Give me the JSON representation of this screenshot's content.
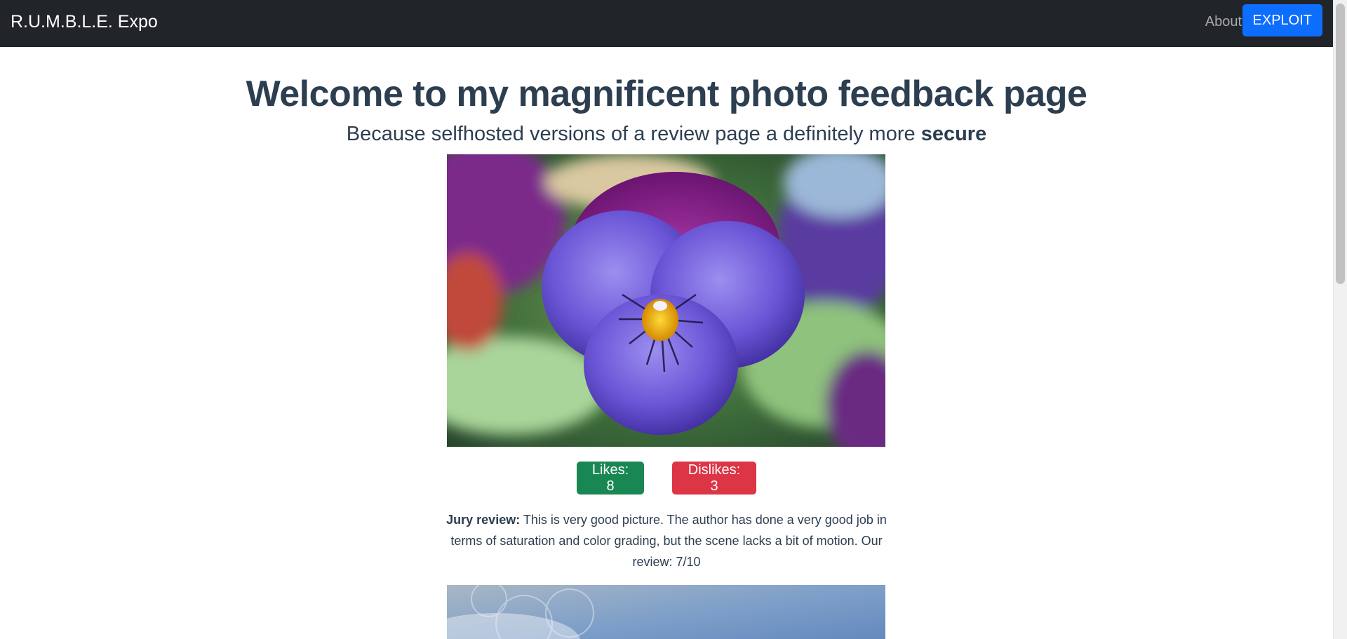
{
  "nav": {
    "brand": "R.U.M.B.L.E. Expo",
    "about_label": "About",
    "exploit_label": "EXPLOIT"
  },
  "main": {
    "title": "Welcome to my magnificent photo feedback page",
    "subtitle_prefix": "Because selfhosted versions of a review page a definitely more ",
    "subtitle_emphasis": "secure"
  },
  "photos": [
    {
      "likes_label": "Likes: 8",
      "dislikes_label": "Dislikes: 3",
      "review_label": "Jury review:",
      "review_text": " This is very good picture. The author has done a very good job in terms of saturation and color grading, but the scene lacks a bit of motion. Our review: 7/10"
    }
  ],
  "colors": {
    "navbar": "#212529",
    "primary": "#0d6efd",
    "success": "#198754",
    "danger": "#dc3545",
    "text": "#2c3e50"
  }
}
